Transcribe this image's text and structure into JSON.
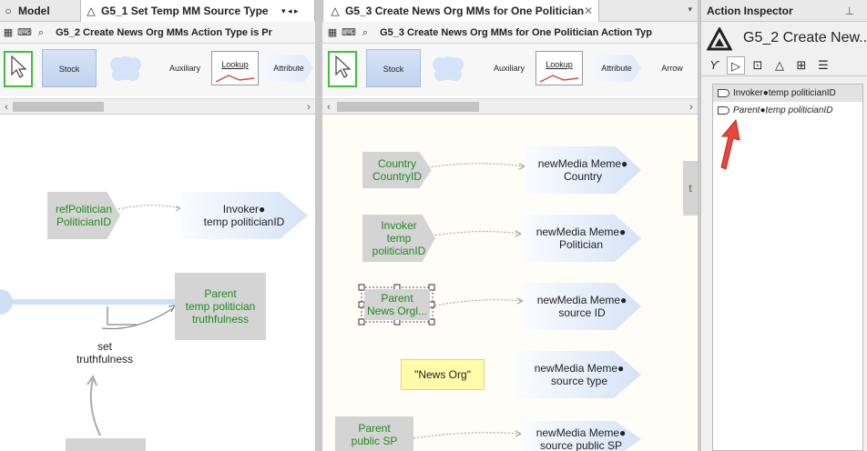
{
  "left_pane": {
    "tab_model": "Model",
    "tab_active": "G5_1 Set Temp MM Source Type",
    "subtitle": "G5_2 Create News Org MMs  Action Type is Pr",
    "palette": {
      "stock": "Stock",
      "auxiliary": "Auxiliary",
      "lookup": "Lookup",
      "attribute": "Attribute"
    },
    "nodes": {
      "ref_politician": "refPolitician\nPoliticianID",
      "invoker": "Invoker●\ntemp politicianID",
      "parent": "Parent\ntemp politician\ntruthfulness",
      "set_truthfulness": "set\ntruthfulness"
    }
  },
  "mid_pane": {
    "tab_active": "G5_3 Create News Org MMs for One Politician",
    "subtitle": "G5_3 Create News Org MMs for One Politician  Action Typ",
    "palette": {
      "stock": "Stock",
      "auxiliary": "Auxiliary",
      "lookup": "Lookup",
      "attribute": "Attribute",
      "arrow": "Arrow"
    },
    "nodes": {
      "country": "Country\nCountryID",
      "invoker": "Invoker\ntemp\npoliticianID",
      "parent_news": "Parent\nNews Orgl...",
      "news_org_const": "\"News Org\"",
      "parent_public": "Parent\npublic SP",
      "meme_country": "newMedia Meme●\nCountry",
      "meme_politician": "newMedia Meme●\nPolitician",
      "meme_source_id": "newMedia Meme●\nsource ID",
      "meme_source_type": "newMedia Meme●\nsource type",
      "meme_public": "newMedia Meme●\nsource public SP",
      "edge_t": "t"
    }
  },
  "inspector": {
    "title": "Action Inspector",
    "heading": "G5_2 Create New...",
    "items": [
      "Invoker●temp politicianID",
      "Parent●temp politicianID"
    ]
  },
  "colors": {
    "accent_green": "#3fbf3f",
    "annotation_red": "#e8463a",
    "node_green_text": "#1f8a1f"
  }
}
